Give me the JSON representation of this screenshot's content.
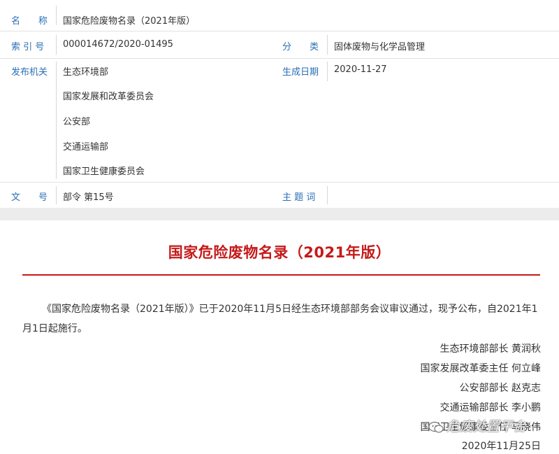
{
  "meta": {
    "name_label": "名　　称",
    "name_value": "国家危险废物名录（2021年版）",
    "index_label": "索 引 号",
    "index_value": "000014672/2020-01495",
    "category_label": "分　　类",
    "category_value": "固体废物与化学品管理",
    "issuer_label": "发布机关",
    "issuers": [
      "生态环境部",
      "国家发展和改革委员会",
      "公安部",
      "交通运输部",
      "国家卫生健康委员会"
    ],
    "date_label": "生成日期",
    "date_value": "2020-11-27",
    "docno_label": "文　　号",
    "docno_value": "部令 第15号",
    "subject_label": "主 题 词",
    "subject_value": ""
  },
  "doc": {
    "title": "国家危险废物名录（2021年版）",
    "paragraph": "《国家危险废物名录（2021年版）》已于2020年11月5日经生态环境部部务会议审议通过，现予公布，自2021年1月1日起施行。",
    "signatures": [
      "生态环境部部长 黄润秋",
      "国家发展改革委主任 何立峰",
      "公安部部长 赵克志",
      "交通运输部部长 李小鹏",
      "国家卫生健康委主任 马晓伟"
    ],
    "date": "2020年11月25日"
  },
  "watermark": {
    "text": "危废处置平台",
    "icon": "wechat-bubble-icon"
  },
  "colors": {
    "label_blue": "#2a6fb5",
    "title_red": "#c51a1a"
  }
}
